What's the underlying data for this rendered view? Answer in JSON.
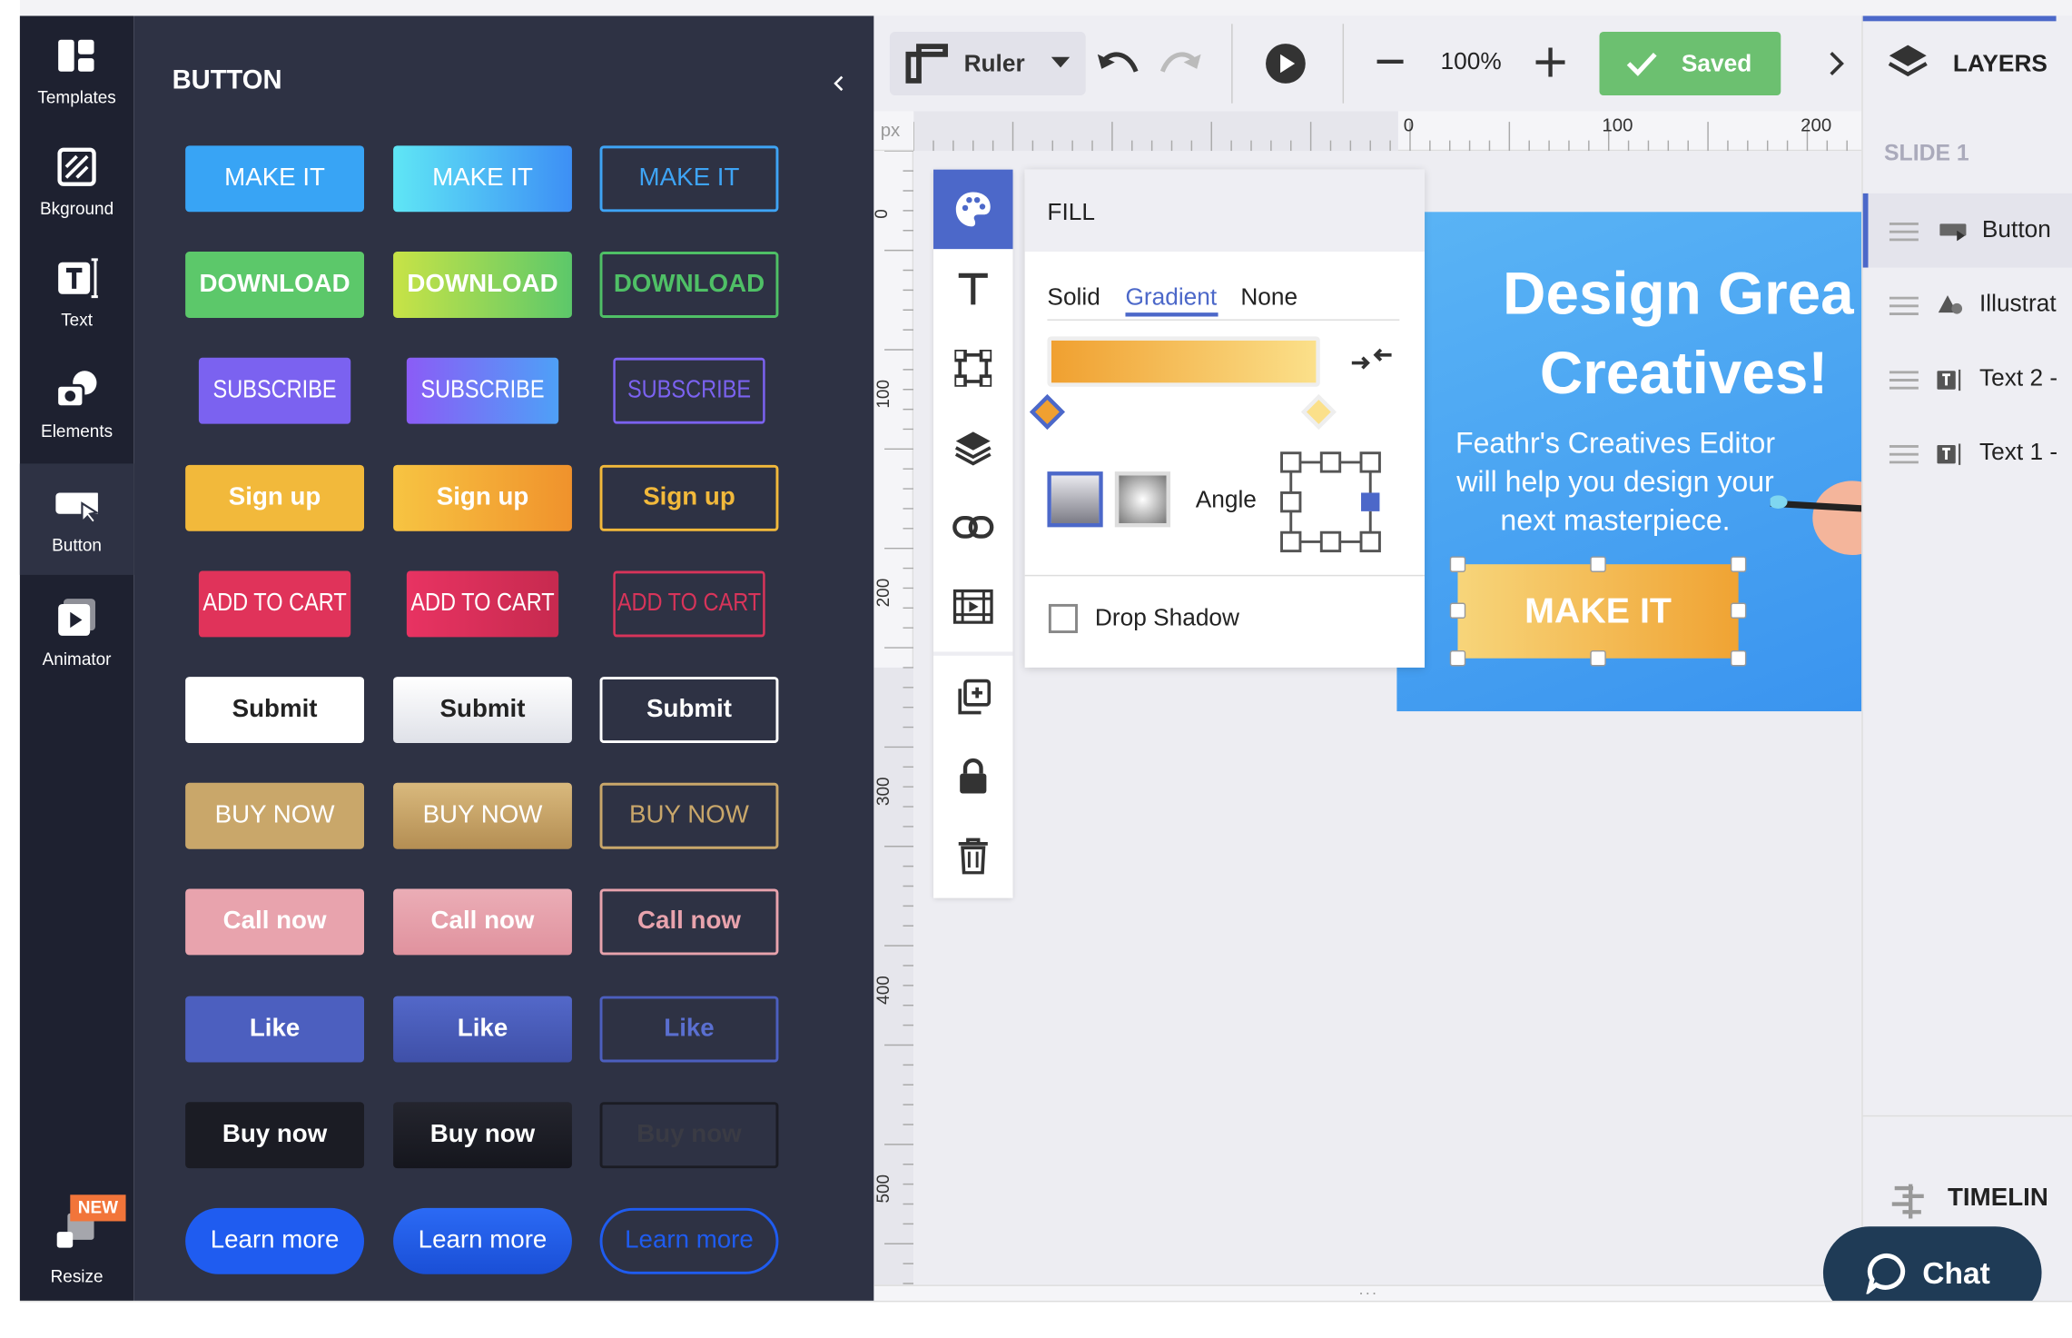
{
  "rail": {
    "items": [
      {
        "label": "Templates",
        "icon": "templates-icon"
      },
      {
        "label": "Bkground",
        "icon": "background-icon"
      },
      {
        "label": "Text",
        "icon": "text-icon"
      },
      {
        "label": "Elements",
        "icon": "elements-icon"
      },
      {
        "label": "Button",
        "icon": "button-icon"
      },
      {
        "label": "Animator",
        "icon": "animator-icon"
      }
    ],
    "resize_label": "Resize",
    "new_badge": "NEW"
  },
  "panel": {
    "title": "BUTTON",
    "rows": [
      {
        "label": "MAKE IT",
        "styles": [
          "#38a4f5",
          "linear-gradient(90deg,#5fe6f5,#3d8ff5)",
          "outline:#3ea4f5"
        ],
        "text_color": "#fff"
      },
      {
        "label": "DOWNLOAD",
        "styles": [
          "#5cc86a",
          "linear-gradient(90deg,#c8e346,#5cc86a)",
          "outline:#4fc066"
        ],
        "text_color": "#fff"
      },
      {
        "label": "SUBSCRIBE",
        "styles": [
          "#7b62f0",
          "linear-gradient(90deg,#8b5cf6,#4ea0f7)",
          "outline:#7b62f0"
        ],
        "text_color": "#fff"
      },
      {
        "label": "Sign up",
        "styles": [
          "#f2b93b",
          "linear-gradient(90deg,#f7c442,#f0922c)",
          "outline:#f2b93b"
        ],
        "text_color": "#fff"
      },
      {
        "label": "ADD TO CART",
        "styles": [
          "#e0335a",
          "linear-gradient(90deg,#e83362,#c72a4f)",
          "outline:#d8345a"
        ],
        "text_color": "#fff"
      },
      {
        "label": "Submit",
        "styles": [
          "#ffffff",
          "linear-gradient(180deg,#ffffff,#dfe1e8)",
          "outline:#ffffff"
        ],
        "text_color": "#222"
      },
      {
        "label": "BUY NOW",
        "styles": [
          "#c9a76a",
          "linear-gradient(180deg,#d9b97d,#b48e53)",
          "outline:#c9a76a"
        ],
        "text_color": "#fff"
      },
      {
        "label": "Call now",
        "styles": [
          "#e8a3ad",
          "linear-gradient(180deg,#ebadb6,#e0929e)",
          "outline:#e8a3ad"
        ],
        "text_color": "#fff"
      },
      {
        "label": "Like",
        "styles": [
          "#4c5fbf",
          "linear-gradient(180deg,#5368c9,#3f50a8)",
          "outline:#4c5fbf"
        ],
        "text_color": "#fff"
      },
      {
        "label": "Buy now",
        "styles": [
          "#1b1c24",
          "linear-gradient(180deg,#24252e,#15161d)",
          "outline:#1b1c24"
        ],
        "text_color": "#fff"
      },
      {
        "label": "Learn more",
        "styles": [
          "#1f5cf0",
          "linear-gradient(180deg,#2b6af5,#1a4fd6)",
          "outline:#1f5cf0"
        ],
        "text_color": "#fff"
      }
    ]
  },
  "toolbar": {
    "ruler_label": "Ruler",
    "zoom": "100%",
    "saved_label": "Saved"
  },
  "ruler": {
    "unit": "px",
    "h_labels": [
      "0",
      "100",
      "200"
    ],
    "v_labels": [
      "0",
      "100",
      "200",
      "300",
      "400",
      "500"
    ]
  },
  "fill": {
    "title": "FILL",
    "tabs": [
      "Solid",
      "Gradient",
      "None"
    ],
    "active_tab": "Gradient",
    "gradient_start": "#f0a030",
    "gradient_end": "#fbe08a",
    "angle_label": "Angle",
    "drop_shadow_label": "Drop Shadow"
  },
  "design": {
    "title_line1": "Design Grea",
    "title_line2": "Creatives!",
    "body_line1": "Feathr's Creatives Editor",
    "body_line2": "will help you design your",
    "body_line3": "next masterpiece.",
    "button_label": "MAKE IT"
  },
  "layers": {
    "title": "LAYERS",
    "slide_label": "SLIDE 1",
    "items": [
      {
        "label": "Button",
        "icon": "button-layer-icon"
      },
      {
        "label": "Illustrat",
        "icon": "shape-layer-icon"
      },
      {
        "label": "Text 2 -",
        "icon": "text-layer-icon"
      },
      {
        "label": "Text 1 -",
        "icon": "text-layer-icon"
      }
    ],
    "timeline_label": "TIMELIN"
  },
  "chat": {
    "label": "Chat"
  }
}
